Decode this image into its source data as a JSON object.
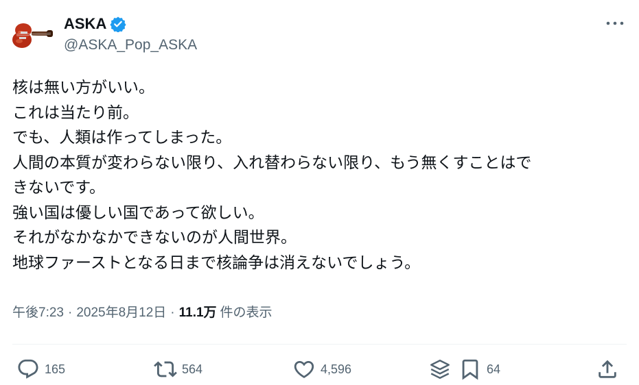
{
  "author": {
    "display_name": "ASKA",
    "handle": "@ASKA_Pop_ASKA",
    "verified": true,
    "avatar_icon": "violin-bass-icon"
  },
  "post": {
    "lines": [
      "核は無い方がいい。",
      "これは当たり前。",
      "でも、人類は作ってしまった。",
      "人間の本質が変わらない限り、入れ替わらない限り、もう無くすことはで",
      "きないです。",
      "強い国は優しい国であって欲しい。",
      "それがなかなかできないのが人間世界。",
      "地球ファーストとなる日まで核論争は消えないでしょう。"
    ]
  },
  "meta": {
    "time": "午後7:23",
    "separator": "·",
    "date": "2025年8月12日",
    "views_count": "11.1万",
    "views_label": "件の表示"
  },
  "actions": {
    "reply_count": "165",
    "repost_count": "564",
    "like_count": "4,596",
    "bookmark_count": "64"
  },
  "colors": {
    "text": "#0f1419",
    "secondary": "#536471",
    "verified": "#1d9bf0",
    "divider": "#eff3f4"
  }
}
